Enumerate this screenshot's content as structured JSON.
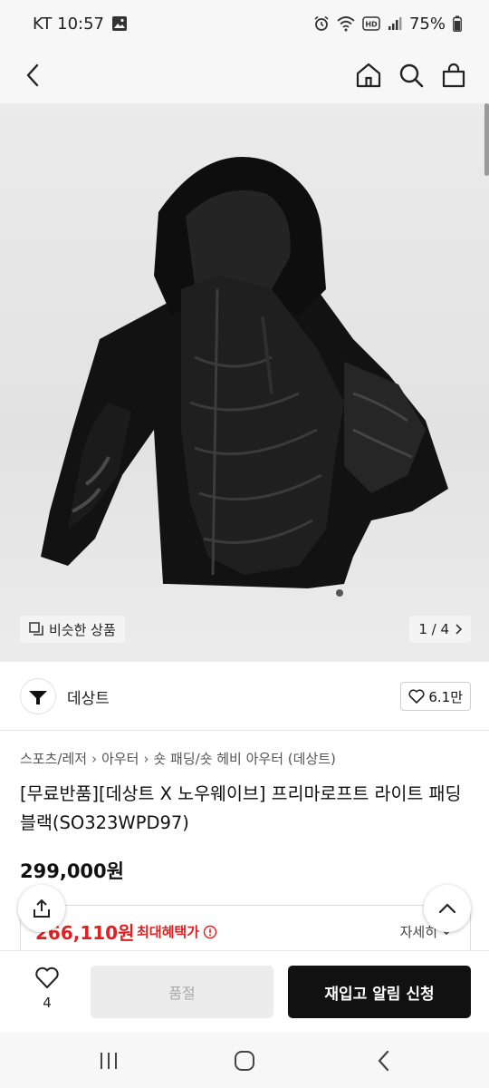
{
  "status_bar": {
    "carrier_time": "KT 10:57",
    "battery": "75%",
    "icons": [
      "gallery-icon",
      "alarm-icon",
      "wifi-icon",
      "hd-icon",
      "signal-icon",
      "battery-icon"
    ]
  },
  "nav": {
    "icons": [
      "back-arrow-icon",
      "home-icon",
      "search-icon",
      "cart-icon"
    ]
  },
  "gallery": {
    "similar_label": "비슷한 상품",
    "page_indicator": "1 / 4"
  },
  "brand": {
    "name": "데상트",
    "likes": "6.1만"
  },
  "breadcrumb": [
    "스포츠/레저",
    "아우터",
    "숏 패딩/숏 헤비 아우터 (데상트)"
  ],
  "product": {
    "title": "[무료반품][데상트 X 노우웨이브] 프리마로프트 라이트 패딩 블랙(SO323WPD97)",
    "price": "299,000원",
    "benefit_price": "266,110원",
    "benefit_label": "최대혜택가",
    "detail_label": "자세히"
  },
  "bottom": {
    "wish_count": "4",
    "soldout_label": "품절",
    "restock_label": "재입고 알림 신청"
  },
  "colors": {
    "accent_red": "#e02020",
    "primary_black": "#111111"
  }
}
